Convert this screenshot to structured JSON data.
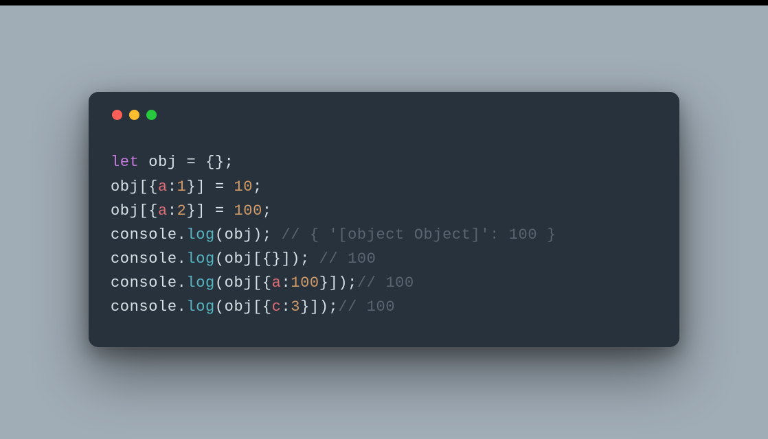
{
  "window": {
    "traffic": [
      "red",
      "yellow",
      "green"
    ]
  },
  "code": {
    "l1": {
      "kw": "let",
      "sp1": " ",
      "id": "obj",
      "rest": " = {};"
    },
    "l2": {
      "a": "obj[{",
      "p": "a",
      "b": ":",
      "n": "1",
      "c": "}] = ",
      "v": "10",
      "d": ";"
    },
    "l3": {
      "a": "obj[{",
      "p": "a",
      "b": ":",
      "n": "2",
      "c": "}] = ",
      "v": "100",
      "d": ";"
    },
    "l4": {
      "a": "console.",
      "fn": "log",
      "b": "(obj); ",
      "cm": "// { '[object Object]': 100 }"
    },
    "l5": {
      "a": "console.",
      "fn": "log",
      "b": "(obj[{}]); ",
      "cm": "// 100"
    },
    "l6": {
      "a": "console.",
      "fn": "log",
      "b": "(obj[{",
      "p": "a",
      "c": ":",
      "n": "100",
      "d": "}]);",
      "cm": "// 100"
    },
    "l7": {
      "a": "console.",
      "fn": "log",
      "b": "(obj[{",
      "p": "c",
      "c": ":",
      "n": "3",
      "d": "}]);",
      "cm": "// 100"
    }
  }
}
